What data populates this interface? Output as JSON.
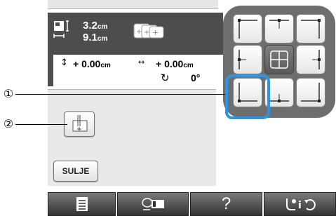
{
  "header": {
    "width_value": "3.2",
    "height_value": "9.1",
    "unit": "cm"
  },
  "position": {
    "y_value": "+ 0.00",
    "x_value": "+ 0.00",
    "unit": "cm",
    "rotation": "0°"
  },
  "callouts": [
    "①",
    "②"
  ],
  "buttons": {
    "close_label": "SULJE",
    "help_label": "?"
  },
  "icons": {
    "size": "size-icon",
    "hoop": "hoop-icon",
    "vertical_arrows": "vertical-arrows-icon",
    "horizontal_arrows": "horizontal-arrows-icon",
    "rotate": "rotate-icon",
    "needle_start": "needle-start-icon",
    "page": "page-icon",
    "embroidery_edit": "embroidery-edit-icon",
    "sewing_info": "sewing-info-icon"
  },
  "grid": {
    "selected": "center",
    "highlighted": "bottom-left"
  },
  "colors": {
    "header_bg": "#4d4d4d",
    "panel_bg": "#e9e9e9",
    "grid_bg": "#6e6e6e",
    "highlight": "#2b96e6",
    "bottom_bar": "#333333"
  }
}
